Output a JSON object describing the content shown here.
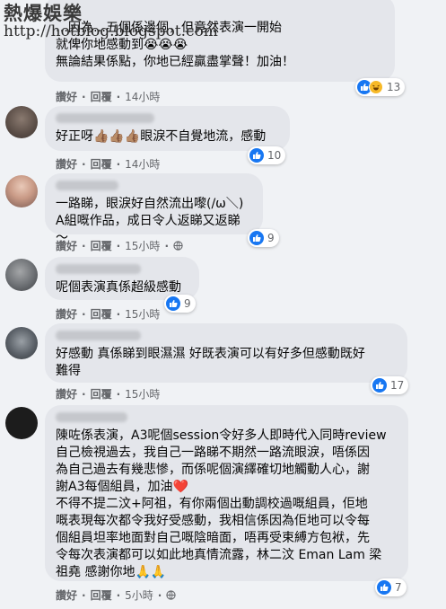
{
  "watermark": {
    "title": "熱爆娛樂",
    "url": "http://hotblog.blogspot.com"
  },
  "actions": {
    "like": "讚好",
    "reply": "回覆",
    "dot": "·"
  },
  "comments": [
    {
      "text": "…因為…五個係邊個，但竟然表演一開始\n就俾你地感動到😭😭😭\n無論結果係點，你地已經贏盡掌聲！加油！",
      "time": "14小時",
      "reactions": 13,
      "reaction_types": [
        "like",
        "haha"
      ]
    },
    {
      "text": "好正呀👍🏽👍🏽👍🏽眼淚不自覺地流，感動",
      "time": "14小時",
      "reactions": 10,
      "reaction_types": [
        "like"
      ]
    },
    {
      "text": "一路睇，眼淚好自然流出嚟(/ω＼)\nA組嘅作品，成日令人返睇又返睇～",
      "time": "15小時",
      "reactions": 9,
      "reaction_types": [
        "like"
      ]
    },
    {
      "text": "呢個表演真係超級感動",
      "time": "15小時",
      "reactions": 9,
      "reaction_types": [
        "like"
      ]
    },
    {
      "text": "好感動 真係睇到眼濕濕 好既表演可以有好多但感動既好\n難得",
      "time": "15小時",
      "reactions": 17,
      "reaction_types": [
        "like"
      ]
    },
    {
      "text": "陳咗係表演，A3呢個session令好多人即時代入同時review\n自己檢視過去，我自己一路睇不期然一路流眼淚，唔係因\n為自己過去有幾悲慘，而係呢個演繹確切地觸動人心，謝\n謝A3每個組員，加油❤️\n不得不提二汶+阿祖，有你兩個出動調校過嘅組員，佢地\n嘅表現每次都令我好受感動，我相信係因為佢地可以令每\n個組員坦率地面對自己嘅陰暗面，唔再受束縛方包袱，先\n令每次表演都可以如此地真情流露，林二汶 Eman Lam 梁\n祖堯 感謝你地🙏🙏",
      "time": "5小時",
      "reactions": 7,
      "reaction_types": [
        "like"
      ]
    }
  ]
}
